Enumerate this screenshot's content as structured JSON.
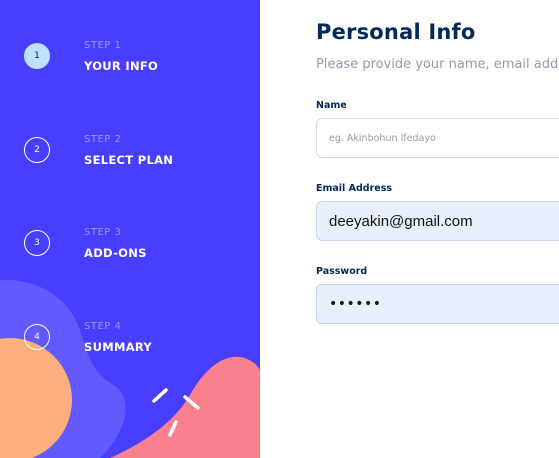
{
  "sidebar": {
    "colors": {
      "background": "#483eff",
      "active_step": "#bee2fd",
      "blob_purple": "#6259ff",
      "blob_orange": "#ffaf7e",
      "blob_pink": "#f9818e"
    },
    "steps": [
      {
        "number": "1",
        "kicker": "STEP 1",
        "title": "YOUR INFO",
        "active": true
      },
      {
        "number": "2",
        "kicker": "STEP 2",
        "title": "SELECT PLAN",
        "active": false
      },
      {
        "number": "3",
        "kicker": "STEP 3",
        "title": "ADD-ONS",
        "active": false
      },
      {
        "number": "4",
        "kicker": "STEP 4",
        "title": "SUMMARY",
        "active": false
      }
    ]
  },
  "main": {
    "title": "Personal Info",
    "subtitle": "Please provide your name, email address",
    "fields": {
      "name": {
        "label": "Name",
        "placeholder": "eg. Akinbohun Ifedayo",
        "value": ""
      },
      "email": {
        "label": "Email Address",
        "value": "deeyakin@gmail.com"
      },
      "password": {
        "label": "Password",
        "value": "••••••"
      }
    }
  }
}
